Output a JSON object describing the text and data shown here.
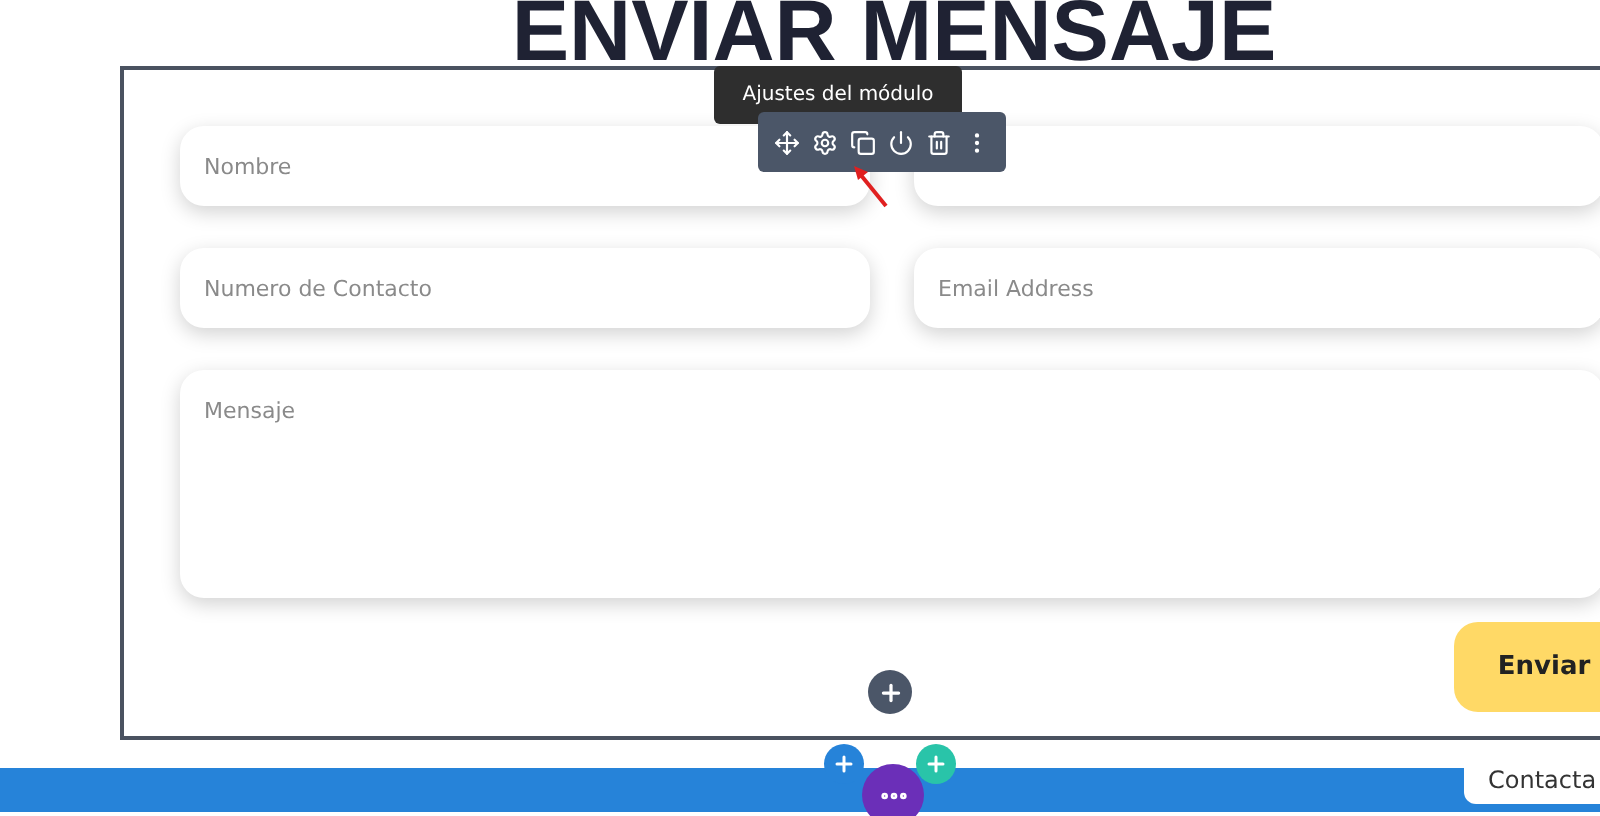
{
  "heading": "ENVIAR MENSAJE",
  "module_toolbar": {
    "tooltip": "Ajustes del módulo"
  },
  "form": {
    "fields": [
      {
        "kind": "input",
        "placeholder": "Nombre"
      },
      {
        "kind": "input"
      },
      {
        "kind": "input",
        "placeholder": "Numero de Contacto"
      },
      {
        "kind": "input",
        "placeholder": "Email Address"
      },
      {
        "kind": "textarea",
        "placeholder": "Mensaje"
      }
    ],
    "submit": "Enviar"
  },
  "footer": {
    "tab": "Contacta"
  }
}
